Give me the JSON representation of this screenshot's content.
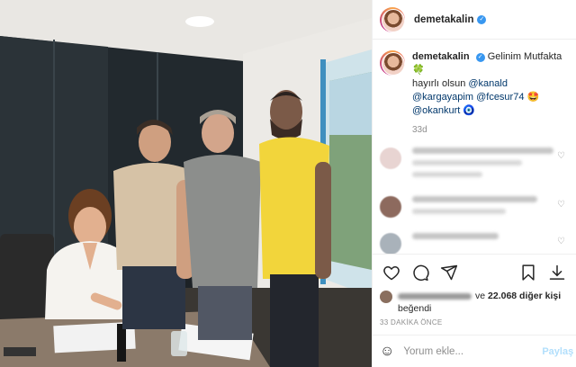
{
  "header": {
    "username": "demetakalin",
    "verified_icon": "verified-badge-icon"
  },
  "caption": {
    "username": "demetakalin",
    "text": "Gelinim Mutfakta",
    "clover_emoji": "🍀",
    "line2": "hayırlı olsun",
    "mention1": "@kanald",
    "mention2": "@kargayapim",
    "mention3": "@fcesur74",
    "emoji2": "🤩",
    "mention4": "@okankurt",
    "emoji3": "🧿",
    "age": "33d"
  },
  "actions": {
    "like": "heart-icon",
    "comment": "comment-icon",
    "share": "share-icon",
    "save": "bookmark-icon",
    "download": "download-icon"
  },
  "likes": {
    "connector": "ve",
    "count_text": "22.068 diğer kişi",
    "suffix": "beğendi"
  },
  "timestamp": "33 DAKİKA ÖNCE",
  "comment_box": {
    "placeholder": "Yorum ekle...",
    "post_label": "Paylaş"
  },
  "colors": {
    "accent": "#3897f0",
    "mention": "#00376b",
    "muted": "#8e8e8e",
    "post_disabled": "#b2dffc"
  }
}
